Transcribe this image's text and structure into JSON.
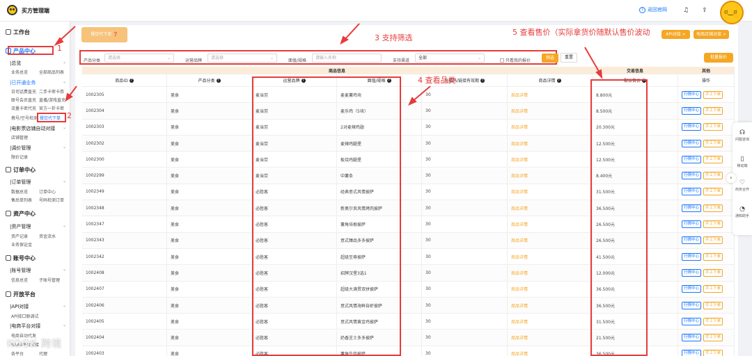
{
  "app": {
    "title": "买方管理端"
  },
  "topbar": {
    "help_label": "返回官网",
    "help_icon": "help-circle-icon",
    "bell_icon": "bell-icon",
    "upload_icon": "upload-icon"
  },
  "sidebar": {
    "workbench": "工作台",
    "product_center": "产品中心",
    "groups": [
      {
        "label": "|总览",
        "items": [
          "业务总览",
          "全部商品列表"
        ]
      },
      {
        "label": "|已开通业务",
        "items": [
          "日司话费直充",
          "二手卡密卡券",
          "联号会员直充",
          "直播/游戏直充",
          "流量卡密代充",
          "官方一折卡密",
          "携号/空号检测",
          "餐饮代下单"
        ]
      },
      {
        "label": "|电影票店铺自动对接",
        "items": [
          "店铺管理"
        ]
      },
      {
        "label": "|调价管理",
        "items": [
          "限价记录"
        ]
      }
    ],
    "order_center": "订单中心",
    "order_group": {
      "label": "|订单管理",
      "items": [
        "数据总览",
        "订单中心",
        "售后单列表",
        "号码检测订单"
      ]
    },
    "asset_center": "资产中心",
    "asset_group": {
      "label": "|资产管理",
      "items": [
        "资产记录",
        "资金流水",
        "业务保证金"
      ]
    },
    "account_center": "账号中心",
    "account_group": {
      "label": "|账号管理",
      "items": [
        "信息总览",
        "子账号管理"
      ]
    },
    "open_platform": "开放平台",
    "api_group": {
      "label": "|API对接",
      "items": [
        "API接口联调试"
      ]
    },
    "ec_group": {
      "label": "|电商平台对接",
      "items": [
        "电商自动代发",
        "SAAS平台对接",
        "各平台",
        "代理"
      ]
    }
  },
  "toolbar": {
    "export_label": "餐饮代下单 ❓",
    "api_label": "API对接 >",
    "ec_label": "电商店铺对接 >",
    "bulk_label": "批量报价",
    "reset_label": "重置",
    "search_label": "筛选"
  },
  "filters": {
    "category_label": "产品分类",
    "category_placeholder": "请选择",
    "brand_label": "运营品牌",
    "brand_placeholder": "请选择",
    "spec_label": "面值/规格",
    "spec_placeholder": "请输入名称",
    "channel_label": "支持渠道",
    "channel_value": "全部",
    "only_mine": "只看我的报价"
  },
  "table": {
    "group_headers": [
      "商品信息",
      "交易信息",
      "其他"
    ],
    "headers": [
      "商品ID",
      "产品分类",
      "运营品牌",
      "面值/规格",
      "兑换码/链接有效期",
      "商品详情",
      "默认售价",
      "操作"
    ],
    "detail_text": "商品详情",
    "action_blue": "行情中心",
    "action_orange": "手工下单",
    "rows": [
      [
        "1002305",
        "美食",
        "麦当劳",
        "麦麦薯鸡块",
        "30",
        "8.800元"
      ],
      [
        "1002304",
        "美食",
        "麦当劳",
        "麦乐鸡（5块）",
        "30",
        "8.500元"
      ],
      [
        "1002303",
        "美食",
        "麦当劳",
        "2对麦辣鸡翅",
        "30",
        "20.300元"
      ],
      [
        "1002302",
        "美食",
        "麦当劳",
        "麦辣鸡腿堡",
        "30",
        "12.500元"
      ],
      [
        "1002300",
        "美食",
        "麦当劳",
        "板烧鸡腿堡",
        "30",
        "12.500元"
      ],
      [
        "1002299",
        "美食",
        "麦当劳",
        "中薯条",
        "30",
        "8.400元"
      ],
      [
        "1002349",
        "美食",
        "必胜客",
        "经典意式风情披萨",
        "30",
        "31.500元"
      ],
      [
        "1002348",
        "美食",
        "必胜客",
        "新奥尔良风情烤肉披萨",
        "30",
        "36.500元"
      ],
      [
        "1002347",
        "美食",
        "必胜客",
        "薯角培根披萨",
        "30",
        "26.500元"
      ],
      [
        "1002343",
        "美食",
        "必胜客",
        "意式臻品多多披萨",
        "30",
        "26.500元"
      ],
      [
        "1002342",
        "美食",
        "必胜客",
        "超级至尊披萨",
        "30",
        "41.500元"
      ],
      [
        "1002408",
        "美食",
        "必胜客",
        "招牌汉堡3选1",
        "30",
        "12.000元"
      ],
      [
        "1002407",
        "美食",
        "必胜客",
        "超级大满贯双拼披萨",
        "30",
        "36.500元"
      ],
      [
        "1002406",
        "美食",
        "必胜客",
        "意式风情海鲜自虾披萨",
        "30",
        "36.500元"
      ],
      [
        "1002405",
        "美食",
        "必胜客",
        "意式风情黄金鸡披萨",
        "30",
        "31.500元"
      ],
      [
        "1002404",
        "美食",
        "必胜客",
        "奶香芝士多多披萨",
        "30",
        "21.500元"
      ],
      [
        "1002403",
        "美食",
        "必胜客",
        "薯角牛肉披萨",
        "30",
        "36.500元"
      ]
    ]
  },
  "annotations": {
    "a1": "1",
    "a2": "2",
    "a3": "3 支持筛选",
    "a4": "4 查看品类",
    "a5": "5 查看售价（实际拿货价随默认售价波动"
  },
  "float_panel": [
    {
      "icon": "headset-icon",
      "label": "问题咨询"
    },
    {
      "icon": "phone-icon",
      "label": "移动端"
    },
    {
      "icon": "heart-icon",
      "label": "商务合作"
    },
    {
      "icon": "bell-icon",
      "label": "通知助手"
    }
  ],
  "watermark": "KOOK 跨境",
  "colors": {
    "accent": "#f5a623",
    "primary": "#1677ff",
    "annotation": "#e83a3a"
  }
}
